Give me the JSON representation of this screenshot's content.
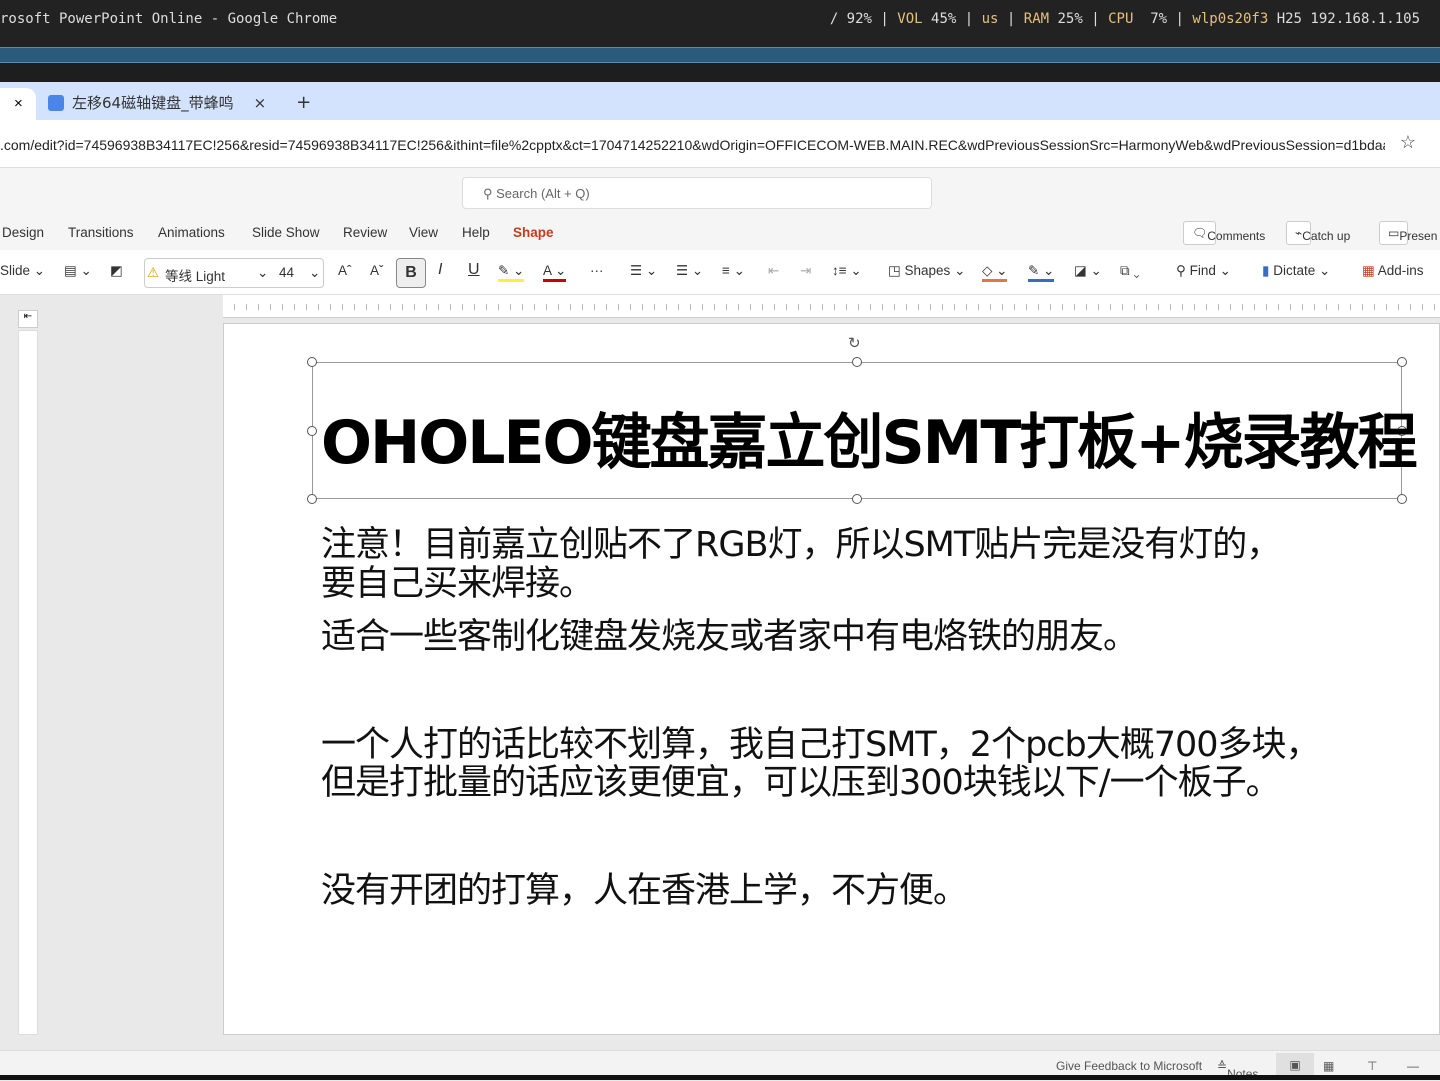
{
  "system_bar": {
    "window_title": "rosoft PowerPoint Online - Google Chrome",
    "battery": "/ 92%",
    "vol_label": "VOL",
    "vol": "45%",
    "layout": "us",
    "ram_label": "RAM",
    "ram": "25%",
    "cpu_label": "CPU",
    "cpu": "7%",
    "iface": "wlp0s20f3",
    "net": "H25 192.168.1.105"
  },
  "browser": {
    "tab_title": "左移64磁轴键盘_带蜂鸣",
    "close": "×",
    "new_tab": "+",
    "url": ".com/edit?id=74596938B34117EC!256&resid=74596938B34117EC!256&ithint=file%2cpptx&ct=1704714252210&wdOrigin=OFFICECOM-WEB.MAIN.REC&wdPreviousSessionSrc=HarmonyWeb&wdPreviousSession=d1bdaab..."
  },
  "search": {
    "placeholder": "Search (Alt + Q)"
  },
  "ribbon_tabs": [
    "Design",
    "Transitions",
    "Animations",
    "Slide Show",
    "Review",
    "View",
    "Help",
    "Shape"
  ],
  "ribbon_buttons": {
    "comments": "Comments",
    "catchup": "Catch up",
    "present": "Presen"
  },
  "toolbar": {
    "new_slide": "Slide",
    "font": "等线 Light",
    "size": "44",
    "bold": "B",
    "italic": "I",
    "underline": "U",
    "shapes": "Shapes",
    "find": "Find",
    "dictate": "Dictate",
    "addins": "Add-ins"
  },
  "slide": {
    "title": "OHOLEO键盘嘉立创SMT打板+烧录教程",
    "lines": [
      "注意！目前嘉立创贴不了RGB灯，所以SMT贴片完是没有灯的，",
      "要自己买来焊接。",
      "适合一些客制化键盘发烧友或者家中有电烙铁的朋友。",
      "一个人打的话比较不划算，我自己打SMT，2个pcb大概700多块，",
      "但是打批量的话应该更便宜，可以压到300块钱以下/一个板子。",
      "没有开团的打算，人在香港上学，不方便。"
    ]
  },
  "status_bar": {
    "feedback": "Give Feedback to Microsoft",
    "notes": "Notes"
  },
  "colors": {
    "accent": "#c43e1c"
  }
}
